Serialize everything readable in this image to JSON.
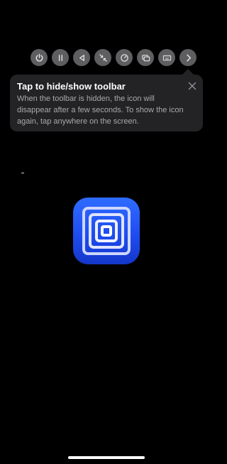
{
  "toolbar": {
    "buttons": [
      {
        "icon": "power-icon"
      },
      {
        "icon": "pause-icon"
      },
      {
        "icon": "back-triangle-icon"
      },
      {
        "icon": "shrink-arrows-icon"
      },
      {
        "icon": "speedometer-icon"
      },
      {
        "icon": "windows-icon"
      },
      {
        "icon": "keyboard-icon"
      },
      {
        "icon": "chevron-right-icon"
      }
    ]
  },
  "tooltip": {
    "title": "Tap to hide/show toolbar",
    "body": "When the toolbar is hidden, the icon will disappear after a few seconds. To show the icon again, tap anywhere on the screen.",
    "close_icon": "close-icon"
  },
  "app_icon": {
    "icon": "nested-squares-icon"
  },
  "colors": {
    "background": "#000000",
    "toolbar_button": "#5e5e60",
    "tooltip_bg": "#232325",
    "tooltip_body_text": "#a9a9ad",
    "icon_blue": "#1f4df0"
  }
}
